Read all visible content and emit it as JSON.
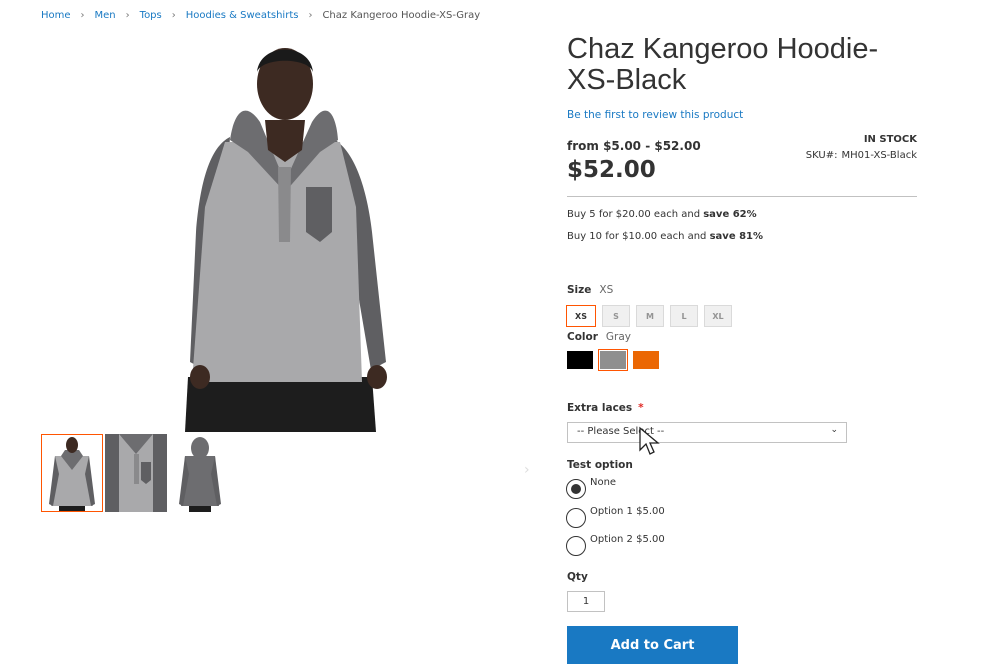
{
  "breadcrumb": {
    "items": [
      "Home",
      "Men",
      "Tops",
      "Hoodies & Sweatshirts"
    ],
    "current": "Chaz Kangeroo Hoodie-XS-Gray"
  },
  "gallery": {
    "main_image": "hoodie-front-model",
    "thumbnails": [
      "hoodie-front-thumb",
      "hoodie-detail-thumb",
      "hoodie-back-thumb"
    ],
    "active_thumb_color": "#ff5501"
  },
  "product": {
    "title": "Chaz Kangeroo Hoodie-XS-Black",
    "review_link": "Be the first to review this product",
    "price_range": "from $5.00 - $52.00",
    "price": "$52.00",
    "stock": "IN STOCK",
    "sku_label": "SKU#:",
    "sku": "MH01-XS-Black"
  },
  "tier_prices": [
    {
      "text": "Buy 5 for $20.00 each and ",
      "save": "save 62%"
    },
    {
      "text": "Buy 10 for $10.00 each and ",
      "save": "save 81%"
    }
  ],
  "size": {
    "label": "Size",
    "selected": "XS",
    "options": [
      "XS",
      "S",
      "M",
      "L",
      "XL"
    ]
  },
  "color": {
    "label": "Color",
    "selected": "Gray",
    "swatches": [
      {
        "name": "Black",
        "hex": "#000000"
      },
      {
        "name": "Gray",
        "hex": "#8f8f8f"
      },
      {
        "name": "Orange",
        "hex": "#eb6703"
      }
    ]
  },
  "extra_laces": {
    "label": "Extra laces",
    "required_mark": "*",
    "value": "-- Please Select --"
  },
  "test_option": {
    "label": "Test option",
    "options": [
      "None",
      "Option 1 $5.00",
      "Option 2 $5.00"
    ],
    "checked": "None"
  },
  "qty": {
    "label": "Qty",
    "value": "1"
  },
  "add_to_cart": "Add to Cart",
  "colors": {
    "accent": "#1979c3",
    "selected_border": "#ff5501"
  }
}
